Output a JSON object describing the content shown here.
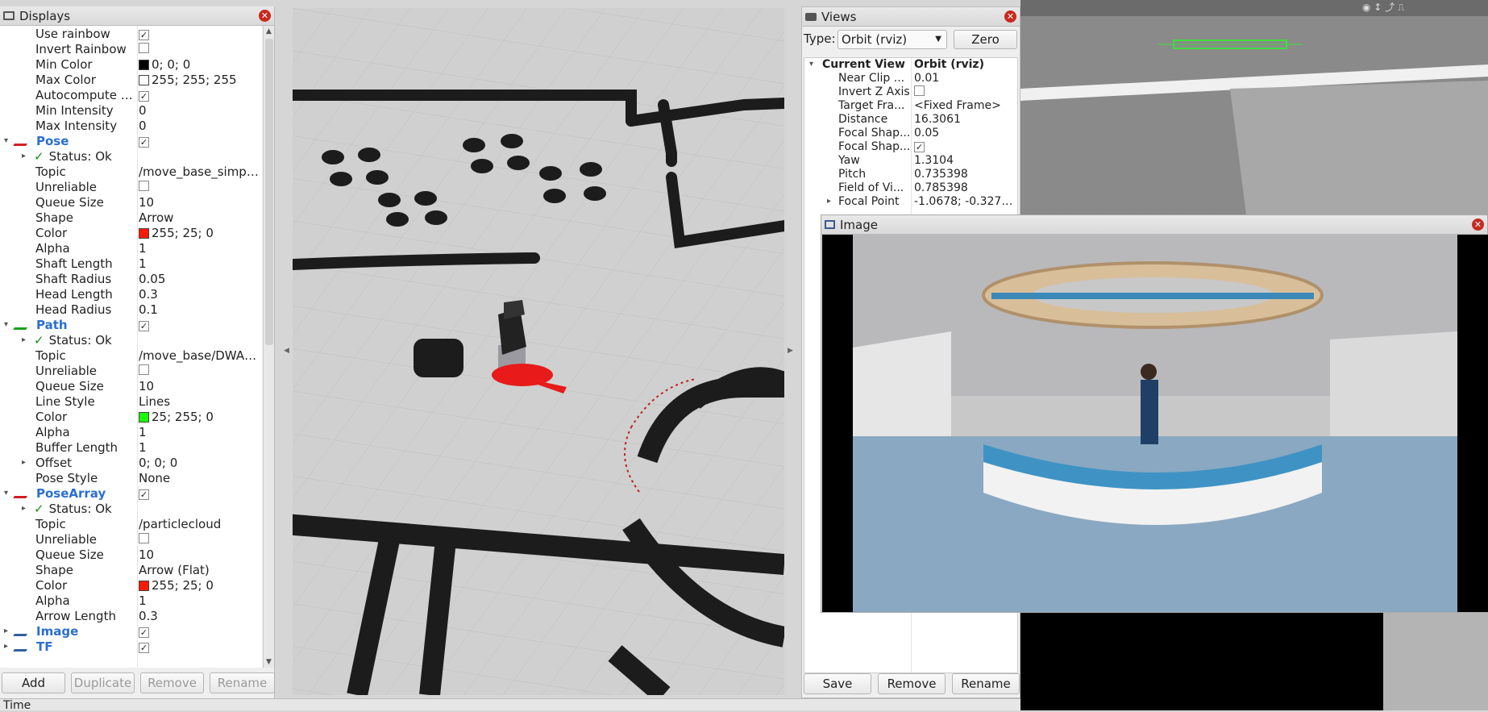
{
  "displays": {
    "title": "Displays",
    "rows": [
      {
        "label": "Use rainbow",
        "kind": "check",
        "checked": true
      },
      {
        "label": "Invert Rainbow",
        "kind": "check",
        "checked": false
      },
      {
        "label": "Min Color",
        "kind": "color",
        "swatch": "#000000",
        "value": "0; 0; 0"
      },
      {
        "label": "Max Color",
        "kind": "color",
        "swatch": "#ffffff",
        "value": "255; 255; 255"
      },
      {
        "label": "Autocompute I...",
        "kind": "check",
        "checked": true
      },
      {
        "label": "Min Intensity",
        "kind": "text",
        "value": "0"
      },
      {
        "label": "Max Intensity",
        "kind": "text",
        "value": "0"
      },
      {
        "label": "Pose",
        "kind": "category",
        "checked": true,
        "icon": "pose-arrow-icon",
        "iconColor": "#d12020",
        "expanded": true
      },
      {
        "label": "Status: Ok",
        "kind": "status"
      },
      {
        "label": "Topic",
        "kind": "text",
        "value": "/move_base_simple..."
      },
      {
        "label": "Unreliable",
        "kind": "check",
        "checked": false
      },
      {
        "label": "Queue Size",
        "kind": "text",
        "value": "10"
      },
      {
        "label": "Shape",
        "kind": "text",
        "value": "Arrow"
      },
      {
        "label": "Color",
        "kind": "color",
        "swatch": "#ff1900",
        "value": "255; 25; 0"
      },
      {
        "label": "Alpha",
        "kind": "text",
        "value": "1"
      },
      {
        "label": "Shaft Length",
        "kind": "text",
        "value": "1"
      },
      {
        "label": "Shaft Radius",
        "kind": "text",
        "value": "0.05"
      },
      {
        "label": "Head Length",
        "kind": "text",
        "value": "0.3"
      },
      {
        "label": "Head Radius",
        "kind": "text",
        "value": "0.1"
      },
      {
        "label": "Path",
        "kind": "category",
        "checked": true,
        "icon": "path-icon",
        "iconColor": "#1aa01a",
        "expanded": true
      },
      {
        "label": "Status: Ok",
        "kind": "status"
      },
      {
        "label": "Topic",
        "kind": "text",
        "value": "/move_base/DWAPl..."
      },
      {
        "label": "Unreliable",
        "kind": "check",
        "checked": false
      },
      {
        "label": "Queue Size",
        "kind": "text",
        "value": "10"
      },
      {
        "label": "Line Style",
        "kind": "text",
        "value": "Lines"
      },
      {
        "label": "Color",
        "kind": "color",
        "swatch": "#19ff00",
        "value": "25; 255; 0"
      },
      {
        "label": "Alpha",
        "kind": "text",
        "value": "1"
      },
      {
        "label": "Buffer Length",
        "kind": "text",
        "value": "1"
      },
      {
        "label": "Offset",
        "kind": "subexp",
        "value": "0; 0; 0"
      },
      {
        "label": "Pose Style",
        "kind": "text",
        "value": "None"
      },
      {
        "label": "PoseArray",
        "kind": "category",
        "checked": true,
        "icon": "pose-array-icon",
        "iconColor": "#d12020",
        "expanded": true
      },
      {
        "label": "Status: Ok",
        "kind": "status"
      },
      {
        "label": "Topic",
        "kind": "text",
        "value": "/particlecloud"
      },
      {
        "label": "Unreliable",
        "kind": "check",
        "checked": false
      },
      {
        "label": "Queue Size",
        "kind": "text",
        "value": "10"
      },
      {
        "label": "Shape",
        "kind": "text",
        "value": "Arrow (Flat)"
      },
      {
        "label": "Color",
        "kind": "color",
        "swatch": "#ff1900",
        "value": "255; 25; 0"
      },
      {
        "label": "Alpha",
        "kind": "text",
        "value": "1"
      },
      {
        "label": "Arrow Length",
        "kind": "text",
        "value": "0.3"
      },
      {
        "label": "Image",
        "kind": "category",
        "checked": true,
        "icon": "image-icon",
        "iconColor": "#3060a0",
        "expanded": false
      },
      {
        "label": "TF",
        "kind": "category",
        "checked": true,
        "icon": "tf-icon",
        "iconColor": "#3060a0",
        "expanded": false
      }
    ],
    "buttons": {
      "add": "Add",
      "duplicate": "Duplicate",
      "remove": "Remove",
      "rename": "Rename"
    }
  },
  "views": {
    "title": "Views",
    "type_label": "Type:",
    "type_value": "Orbit (rviz)",
    "zero_button": "Zero",
    "current_view": {
      "label": "Current View",
      "value": "Orbit (rviz)"
    },
    "rows": [
      {
        "label": "Near Clip ...",
        "value": "0.01",
        "kind": "text"
      },
      {
        "label": "Invert Z Axis",
        "kind": "check",
        "checked": false
      },
      {
        "label": "Target Fra...",
        "value": "<Fixed Frame>",
        "kind": "text"
      },
      {
        "label": "Distance",
        "value": "16.3061",
        "kind": "text"
      },
      {
        "label": "Focal Shap...",
        "value": "0.05",
        "kind": "text"
      },
      {
        "label": "Focal Shap...",
        "kind": "check",
        "checked": true
      },
      {
        "label": "Yaw",
        "value": "1.3104",
        "kind": "text"
      },
      {
        "label": "Pitch",
        "value": "0.735398",
        "kind": "text"
      },
      {
        "label": "Field of Vi...",
        "value": "0.785398",
        "kind": "text"
      },
      {
        "label": "Focal Point",
        "value": "-1.0678; -0.3270...",
        "kind": "expandable"
      }
    ],
    "buttons": {
      "save": "Save",
      "remove": "Remove",
      "rename": "Rename"
    }
  },
  "image_panel": {
    "title": "Image"
  },
  "time_panel": {
    "title": "Time"
  }
}
